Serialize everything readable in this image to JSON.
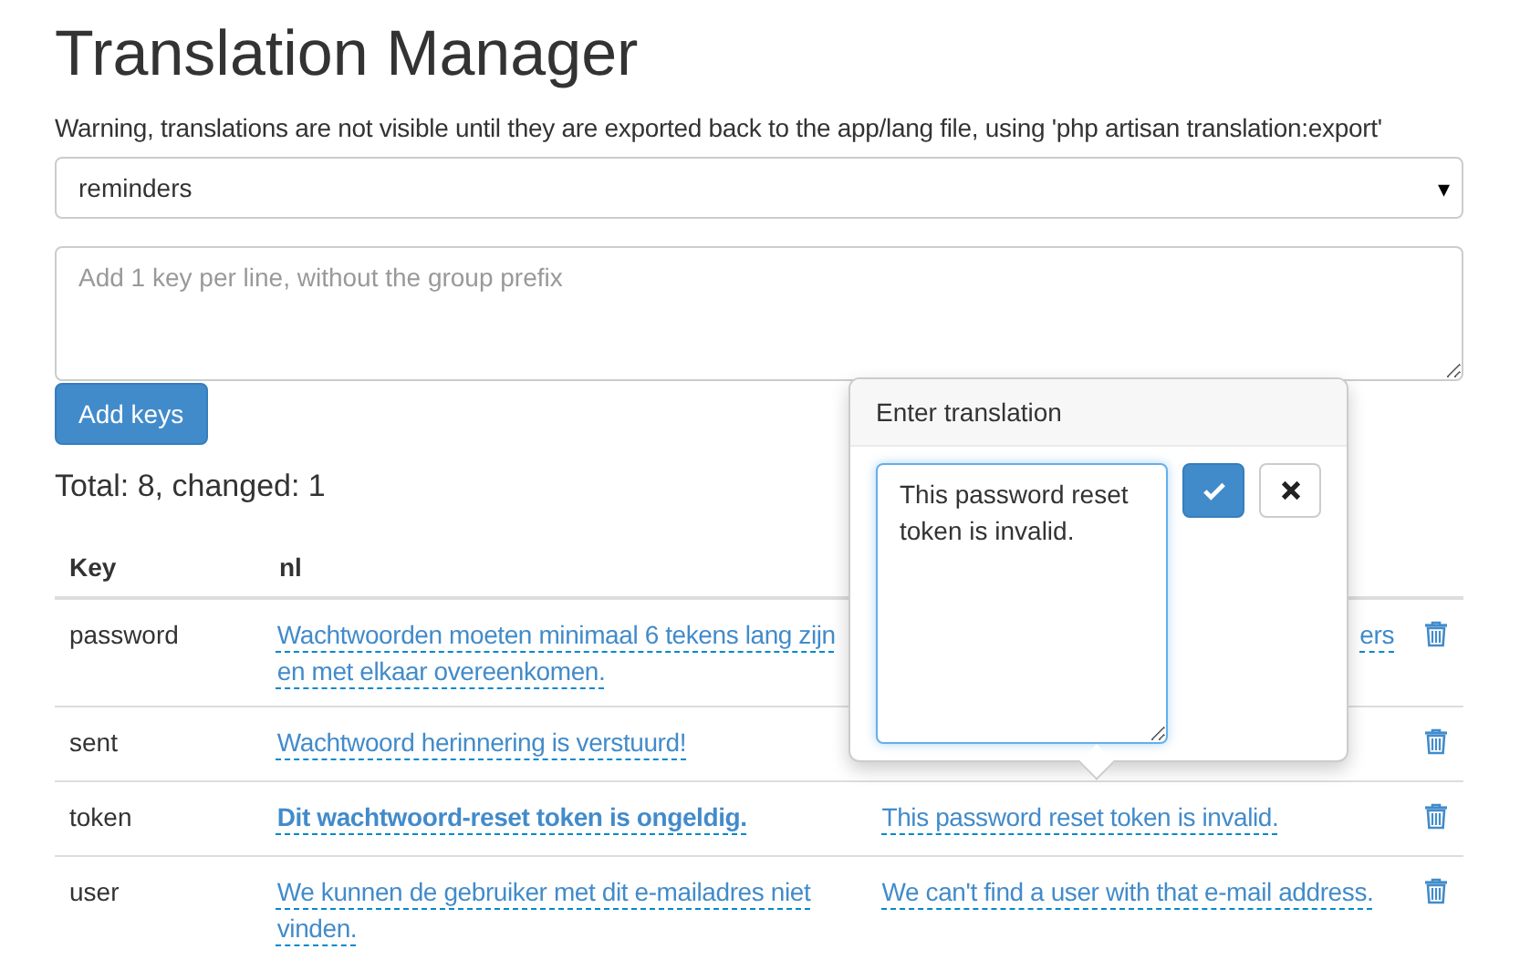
{
  "title": "Translation Manager",
  "warning": "Warning, translations are not visible until they are exported back to the app/lang file, using 'php artisan translation:export'",
  "group_select": {
    "value": "reminders",
    "arrow": "▾"
  },
  "keys_field": {
    "placeholder": "Add 1 key per line, without the group prefix"
  },
  "add_button": "Add keys",
  "totals": "Total: 8, changed: 1",
  "table": {
    "columns": [
      "Key",
      "nl"
    ],
    "rows": [
      {
        "key": "password",
        "nl": {
          "text": "Wachtwoorden moeten minimaal 6 tekens lang zijn en met elkaar overeenkomen.",
          "changed": false
        },
        "en": {
          "text": "ers",
          "changed": false,
          "cut_left": true
        }
      },
      {
        "key": "sent",
        "nl": {
          "text": "Wachtwoord herinnering is verstuurd!",
          "changed": false
        }
      },
      {
        "key": "token",
        "nl": {
          "text": "Dit wachtwoord-reset token is ongeldig.",
          "changed": true
        },
        "en": {
          "text": "This password reset token is invalid.",
          "changed": false,
          "cut_left": false
        }
      },
      {
        "key": "user",
        "nl": {
          "text": "We kunnen de gebruiker met dit e-mailadres niet vinden.",
          "changed": false
        },
        "en": {
          "text": "We can't find a user with that e-mail address.",
          "changed": false,
          "cut_left": false
        }
      }
    ]
  },
  "popover": {
    "title": "Enter translation",
    "value": "This password reset token is invalid."
  }
}
